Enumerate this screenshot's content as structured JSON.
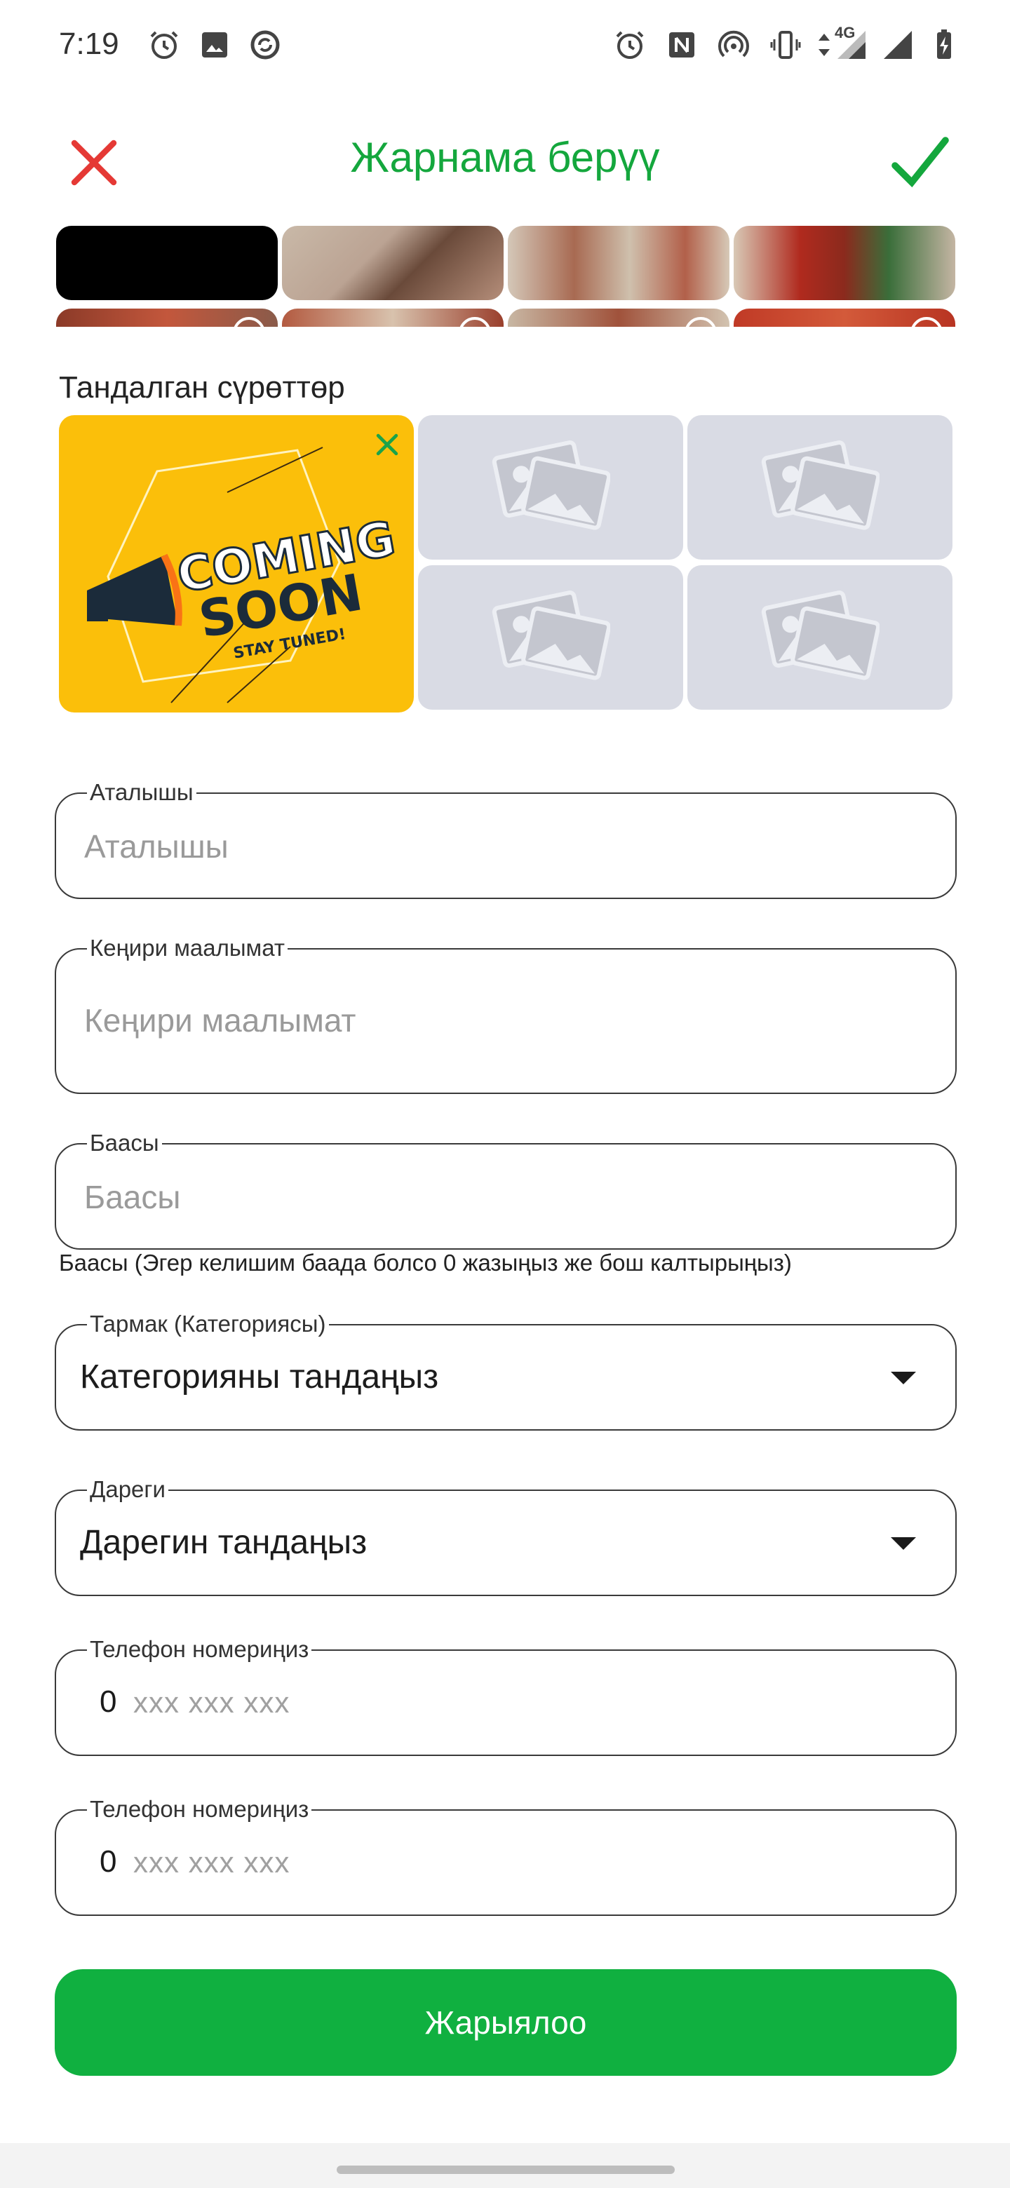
{
  "status_bar": {
    "time": "7:19",
    "network": "4G",
    "icons_left": [
      "alarm-icon",
      "image-icon",
      "sync-icon"
    ],
    "icons_right": [
      "alarm-icon",
      "nfc-icon",
      "hotspot-icon",
      "vibrate-icon",
      "mobile-data-arrows-icon",
      "signal-icon",
      "battery-charging-icon"
    ]
  },
  "app_bar": {
    "title": "Жарнама берүү",
    "close_icon": "close-icon",
    "confirm_icon": "check-icon",
    "close_color": "#e53935",
    "accent_color": "#14a73d"
  },
  "selected_photos": {
    "label": "Тандалган сүрөттөр",
    "main_photo": {
      "line1": "COMING",
      "line2": "SOON",
      "line3": "STAY TUNED!"
    },
    "empty_slots": 4
  },
  "form": {
    "title_field": {
      "legend": "Аталышы",
      "placeholder": "Аталышы"
    },
    "description_field": {
      "legend": "Кеңири маалымат",
      "placeholder": "Кеңири маалымат"
    },
    "price_field": {
      "legend": "Баасы",
      "placeholder": "Баасы",
      "helper": "Баасы (Эгер келишим баада болсо 0 жазыңыз же бош калтырыңыз)"
    },
    "category_field": {
      "legend": "Тармак (Категориясы)",
      "value": "Категорияны тандаңыз"
    },
    "address_field": {
      "legend": "Дареги",
      "value": "Дарегин тандаңыз"
    },
    "phone1_field": {
      "legend": "Телефон номериңиз",
      "prefix": "0",
      "placeholder": "xxx xxx xxx"
    },
    "phone2_field": {
      "legend": "Телефон номериңиз",
      "prefix": "0",
      "placeholder": "xxx xxx xxx"
    }
  },
  "publish_button": {
    "label": "Жарыялоо",
    "color": "#10b040"
  }
}
